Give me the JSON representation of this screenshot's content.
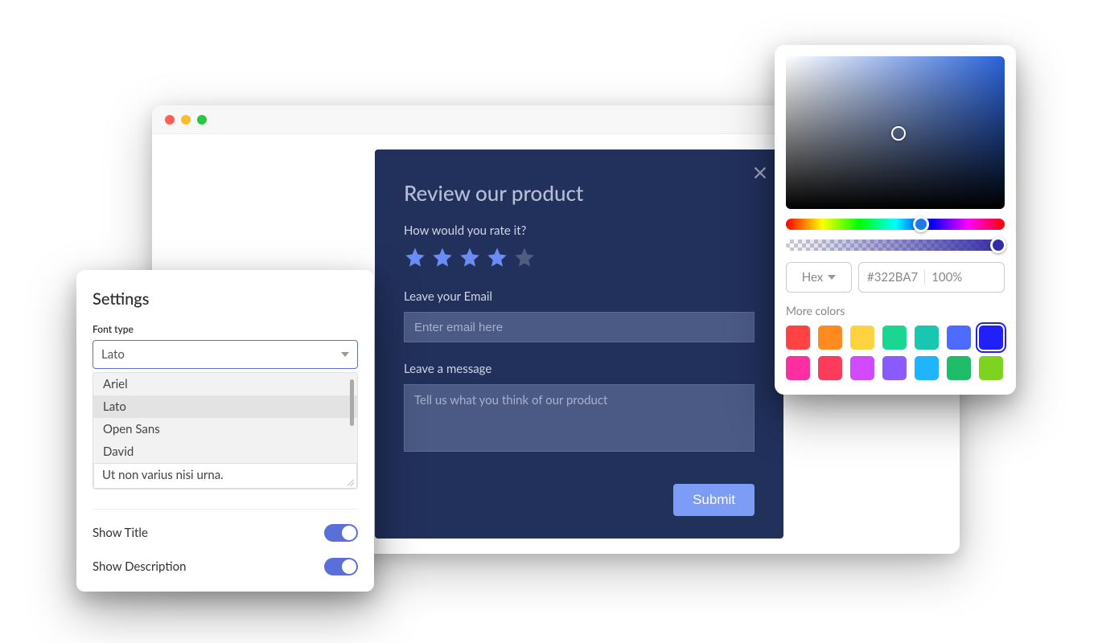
{
  "settings": {
    "title": "Settings",
    "fontTypeLabel": "Font type",
    "selectedFont": "Lato",
    "fontOptions": [
      "Ariel",
      "Lato",
      "Open Sans",
      "David"
    ],
    "previewText": "Ut non varius nisi urna.",
    "showTitleLabel": "Show Title",
    "showTitleOn": true,
    "showDescriptionLabel": "Show Description",
    "showDescriptionOn": true
  },
  "review": {
    "title": "Review our product",
    "rateLabel": "How would you rate it?",
    "rating": 4,
    "ratingMax": 5,
    "emailLabel": "Leave your Email",
    "emailPlaceholder": "Enter email here",
    "messageLabel": "Leave a message",
    "messagePlaceholder": "Tell us what you think of our product",
    "submitLabel": "Submit"
  },
  "colorPicker": {
    "formatLabel": "Hex",
    "hexValue": "#322BA7",
    "opacityValue": "100%",
    "moreColorsLabel": "More colors",
    "swatches": [
      {
        "color": "#ff4242",
        "selected": false
      },
      {
        "color": "#ff8a1f",
        "selected": false
      },
      {
        "color": "#ffd23f",
        "selected": false
      },
      {
        "color": "#19d691",
        "selected": false
      },
      {
        "color": "#19c7b0",
        "selected": false
      },
      {
        "color": "#4d6bff",
        "selected": false
      },
      {
        "color": "#2020ff",
        "selected": true
      },
      {
        "color": "#ff2fa1",
        "selected": false
      },
      {
        "color": "#ff3b5c",
        "selected": false
      },
      {
        "color": "#d14aff",
        "selected": false
      },
      {
        "color": "#8a5cff",
        "selected": false
      },
      {
        "color": "#1fb4ff",
        "selected": false
      },
      {
        "color": "#1fbc6a",
        "selected": false
      },
      {
        "color": "#7ed321",
        "selected": false
      }
    ]
  }
}
